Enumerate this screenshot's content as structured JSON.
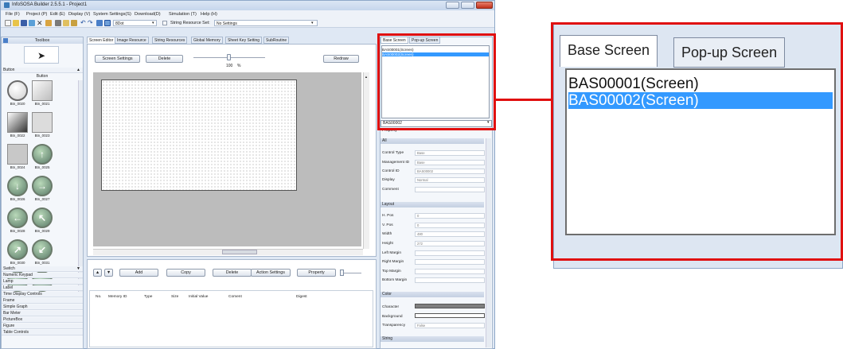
{
  "window": {
    "title": "InfoSOSA Builder 2.5.5.1 - Project1"
  },
  "menu": [
    "File (F)",
    "Project (P)",
    "Edit (E)",
    "Display (V)",
    "System Settings(S)",
    "Download(D)",
    "Simulation (T)",
    "Help (H)"
  ],
  "toolbar": {
    "dot_label": "8Dot",
    "string_resource_label": "String Resource Set:",
    "string_resource_value": "No Settings"
  },
  "toolbox": {
    "title": "Toolbox",
    "section": "Button",
    "section_header": "Button",
    "items": [
      "Btn_0020",
      "Btn_0021",
      "Btn_0022",
      "Btn_0023",
      "Btn_0024",
      "Btn_0025",
      "Btn_0026",
      "Btn_0027",
      "Btn_0028",
      "Btn_0029",
      "Btn_0030",
      "Btn_0031"
    ],
    "categories": [
      "Switch",
      "Numeric Keypad",
      "Lamp",
      "Label",
      "Time Display Controls",
      "Frame",
      "Simple Graph",
      "Bar Meter",
      "PictureBox",
      "Figure",
      "Table Controls"
    ]
  },
  "editor_tabs": [
    "Screen Editor",
    "Image Resource",
    "String Resources",
    "Global Memory",
    "Sheet Key Setting",
    "SubRoutine"
  ],
  "editor": {
    "screen_settings": "Screen Settings",
    "delete": "Delete",
    "redraw": "Redraw",
    "zoom_value": "100",
    "zoom_unit": "%"
  },
  "memory_panel": {
    "up": "▲",
    "down": "▼",
    "add": "Add",
    "copy": "Copy",
    "delete": "Delete",
    "action_settings": "Action Settings",
    "property": "Property",
    "columns": [
      "No.",
      "Memory ID",
      "Type",
      "Size",
      "Initial Value",
      "Coment",
      "Digest"
    ]
  },
  "screens_panel": {
    "tabs": [
      "Base Screen",
      "Pop-up Screen"
    ],
    "items": [
      "BAS00001(Screen)",
      "BAS00002(Screen)"
    ],
    "selected_index": 1,
    "combo_value": "BAS00002"
  },
  "property_panel": {
    "title": "Property",
    "all_header": "All",
    "all_rows": [
      {
        "label": "Control Type",
        "value": "Base"
      },
      {
        "label": "Management ID",
        "value": "Base"
      },
      {
        "label": "Control ID",
        "value": "BAS00002"
      },
      {
        "label": "Display",
        "value": "Normal"
      },
      {
        "label": "Comment",
        "value": ""
      }
    ],
    "layout_header": "Layout",
    "layout_rows": [
      {
        "label": "H. Pos",
        "value": "0"
      },
      {
        "label": "V. Pos",
        "value": "0"
      },
      {
        "label": "Width",
        "value": "480"
      },
      {
        "label": "Height",
        "value": "272"
      },
      {
        "label": "Left Margin",
        "value": ""
      },
      {
        "label": "Right Margin",
        "value": ""
      },
      {
        "label": "Top Margin",
        "value": ""
      },
      {
        "label": "Bottom Margin",
        "value": ""
      }
    ],
    "color_header": "Color",
    "color_rows": [
      {
        "label": "Character",
        "value": ""
      },
      {
        "label": "Background",
        "value": ""
      },
      {
        "label": "Transparency",
        "value": "False"
      }
    ],
    "string_header": "String"
  },
  "colors": {
    "selection": "#3399ff",
    "highlight_red": "#e01010",
    "window_bg": "#dfe8f4"
  }
}
